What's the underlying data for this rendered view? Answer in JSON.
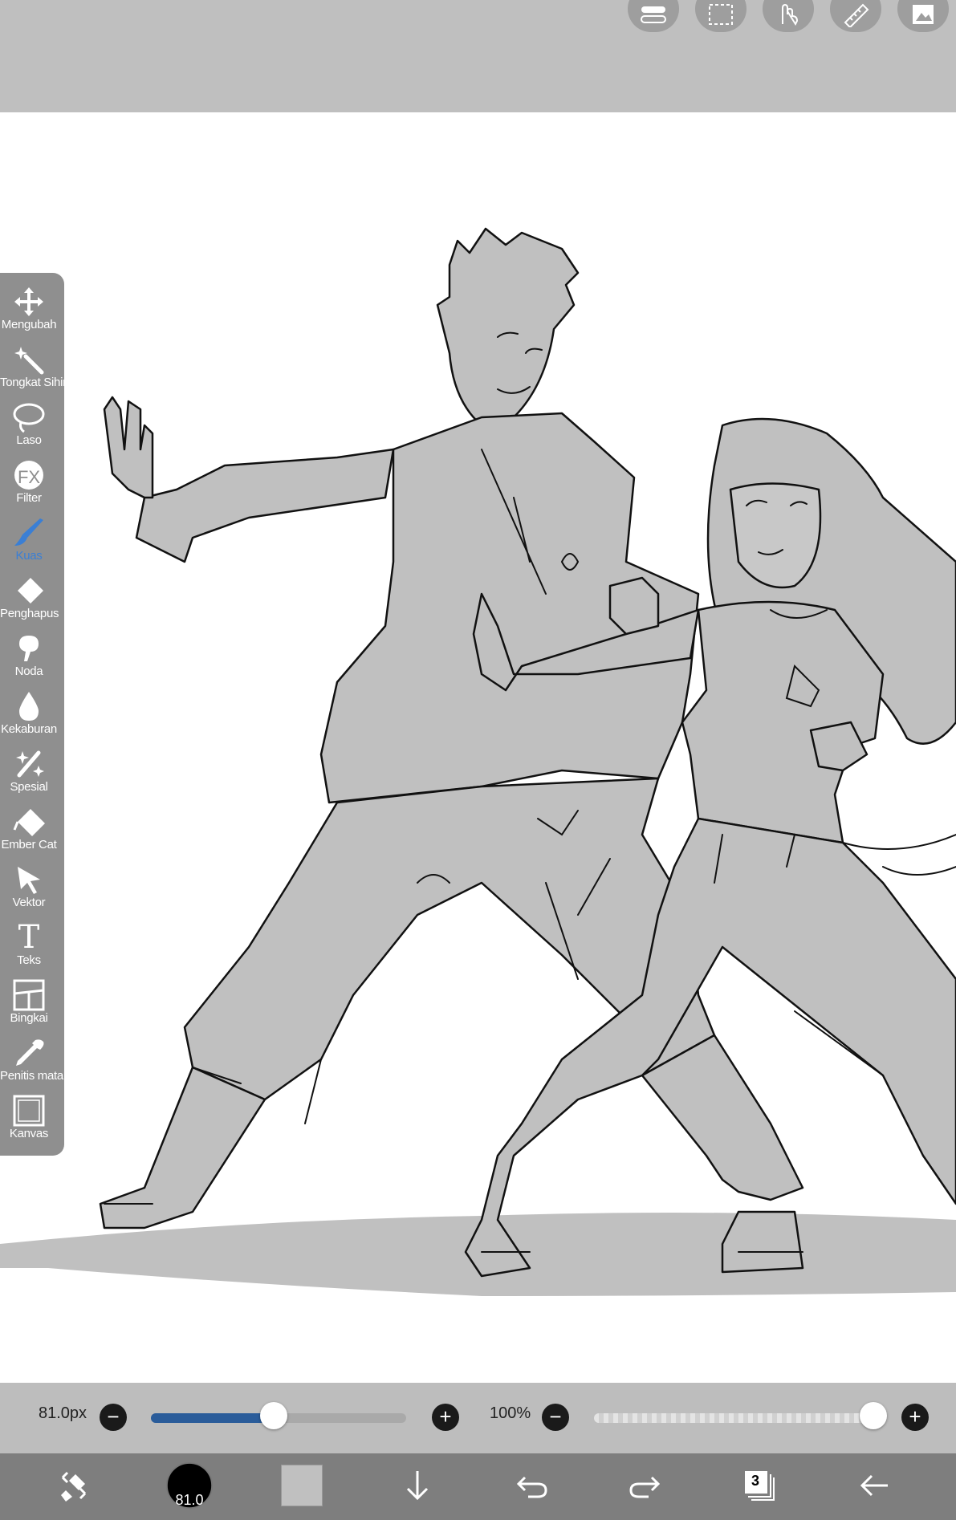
{
  "toolbar_left": {
    "tools": [
      {
        "id": "transform",
        "label": "Mengubah",
        "icon": "move-icon"
      },
      {
        "id": "magic",
        "label": "Tongkat Sihir",
        "icon": "magic-wand-icon"
      },
      {
        "id": "lasso",
        "label": "Laso",
        "icon": "lasso-icon"
      },
      {
        "id": "filter",
        "label": "Filter",
        "icon": "fx-icon",
        "glyph": "FX"
      },
      {
        "id": "brush",
        "label": "Kuas",
        "icon": "brush-icon",
        "active": true
      },
      {
        "id": "eraser",
        "label": "Penghapus",
        "icon": "eraser-icon"
      },
      {
        "id": "smudge",
        "label": "Noda",
        "icon": "smudge-icon"
      },
      {
        "id": "blur",
        "label": "Kekaburan",
        "icon": "blur-drop-icon"
      },
      {
        "id": "special",
        "label": "Spesial",
        "icon": "special-brush-icon"
      },
      {
        "id": "bucket",
        "label": "Ember Cat",
        "icon": "paint-bucket-icon"
      },
      {
        "id": "vector",
        "label": "Vektor",
        "icon": "vector-arrow-icon"
      },
      {
        "id": "text",
        "label": "Teks",
        "icon": "text-icon",
        "glyph": "T"
      },
      {
        "id": "frame",
        "label": "Bingkai",
        "icon": "frame-icon"
      },
      {
        "id": "eyedropper",
        "label": "Penitis mata",
        "icon": "eyedropper-icon"
      },
      {
        "id": "canvas",
        "label": "Kanvas",
        "icon": "canvas-icon"
      }
    ],
    "active_color": "#3a7fd5"
  },
  "toolbar_top": {
    "buttons": [
      {
        "icon": "toggle-icon"
      },
      {
        "icon": "selection-icon"
      },
      {
        "icon": "hand-icon"
      },
      {
        "icon": "ruler-icon"
      },
      {
        "icon": "layer-image-icon"
      }
    ]
  },
  "brush_size": {
    "value_label": "81.0px",
    "fraction": 0.48
  },
  "opacity": {
    "value_label": "100%",
    "fraction": 1.0
  },
  "bottom_bar": {
    "brush_badge": "81.0",
    "layer_count": "3",
    "primary_color": "#c0c0c0",
    "icons": [
      "swap-tool-icon",
      "brush-size-badge",
      "color-swatch",
      "download-icon",
      "undo-icon",
      "redo-icon",
      "layers-icon",
      "back-icon"
    ]
  },
  "colors": {
    "canvas_bg": "#ffffff",
    "gray_fill": "#c0c0c0",
    "toolbar": "#8f8f8f",
    "bottom": "#7e7e7e"
  }
}
